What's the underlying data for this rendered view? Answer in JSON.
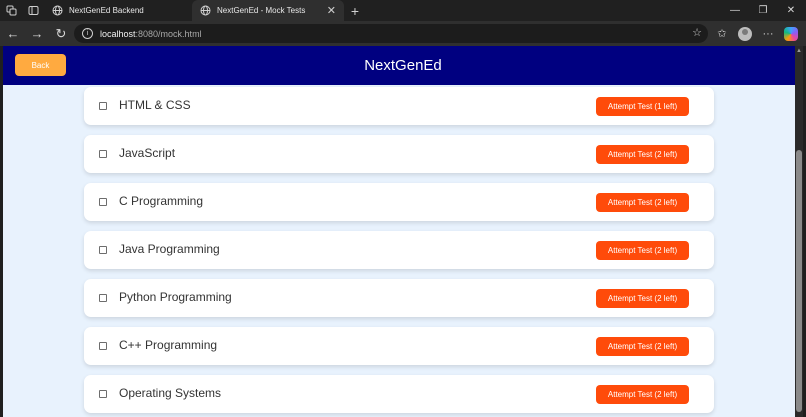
{
  "browser": {
    "tabs": [
      {
        "title": "NextGenEd Backend",
        "active": false
      },
      {
        "title": "NextGenEd - Mock Tests",
        "active": true
      }
    ],
    "address": {
      "host": "localhost",
      "path": ":8080/mock.html"
    }
  },
  "header": {
    "back_label": "Back",
    "brand": "NextGenEd",
    "bg_color": "#000080",
    "back_color": "#ffaa40"
  },
  "tests": [
    {
      "course": "HTML & CSS",
      "button": "Attempt Test (1 left)",
      "checked": false
    },
    {
      "course": "JavaScript",
      "button": "Attempt Test (2 left)",
      "checked": false
    },
    {
      "course": "C Programming",
      "button": "Attempt Test (2 left)",
      "checked": false
    },
    {
      "course": "Java Programming",
      "button": "Attempt Test (2 left)",
      "checked": false
    },
    {
      "course": "Python Programming",
      "button": "Attempt Test (2 left)",
      "checked": false
    },
    {
      "course": "C++ Programming",
      "button": "Attempt Test (2 left)",
      "checked": false
    },
    {
      "course": "Operating Systems",
      "button": "Attempt Test (2 left)",
      "checked": false
    }
  ],
  "accent_color": "#ff4b0a",
  "page_bg": "#e8f2fd",
  "icons": {
    "workspaces": "workspaces-icon",
    "tab_actions": "tab-actions-icon",
    "globe": "globe-icon",
    "back": "arrow-left-icon",
    "forward": "arrow-right-icon",
    "refresh": "refresh-icon",
    "info": "info-icon",
    "favorite": "star-icon",
    "favorites": "favorites-icon",
    "profile": "profile-icon",
    "more": "more-icon",
    "copilot": "copilot-icon"
  }
}
